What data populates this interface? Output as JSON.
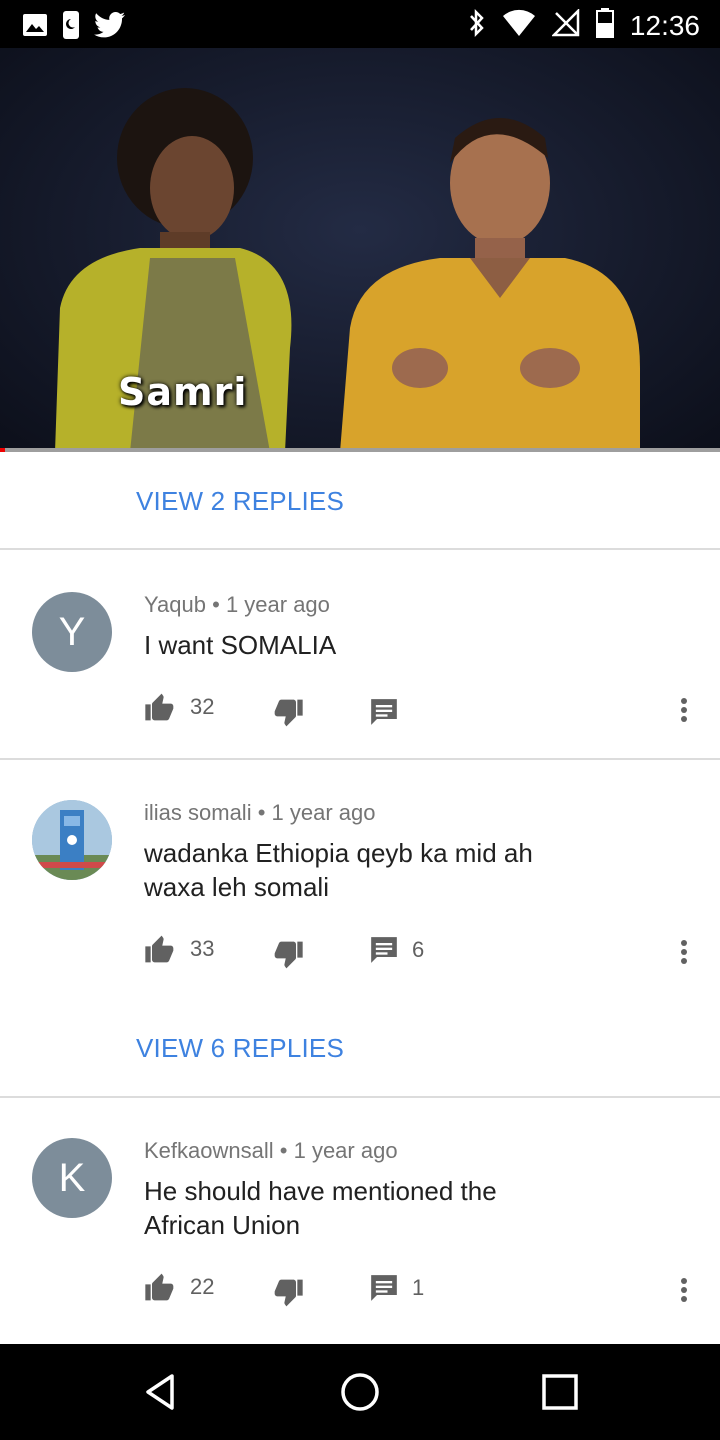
{
  "status_bar": {
    "time": "12:36",
    "left_icons": [
      "image-icon",
      "notification-icon",
      "twitter-icon"
    ],
    "right_icons": [
      "bluetooth-icon",
      "wifi-icon",
      "no-signal-icon",
      "battery-icon"
    ]
  },
  "video": {
    "caption": "Samri",
    "progress_fraction": 0.007
  },
  "replies_top": {
    "label": "VIEW 2 REPLIES"
  },
  "comments": [
    {
      "avatar_letter": "Y",
      "author": "Yaqub",
      "time": "1 year ago",
      "text": "I want SOMALIA",
      "likes": "32",
      "replies": ""
    },
    {
      "avatar_letter": "",
      "author": "ilias somali",
      "time": "1 year ago",
      "text": "wadanka Ethiopia  qeyb ka mid ah waxa leh somali",
      "likes": "33",
      "replies": "6"
    },
    {
      "avatar_letter": "K",
      "author": "Kefkaownsall",
      "time": "1 year ago",
      "text": "He should have mentioned the African Union",
      "likes": "22",
      "replies": "1"
    }
  ],
  "replies_mid": {
    "label": "VIEW 6 REPLIES"
  },
  "colors": {
    "accent_link": "#3e82e0",
    "avatar_bg": "#7d8d9a",
    "progress_played": "#ee0000"
  },
  "nav": {
    "buttons": [
      "back-icon",
      "home-icon",
      "recents-icon"
    ]
  }
}
